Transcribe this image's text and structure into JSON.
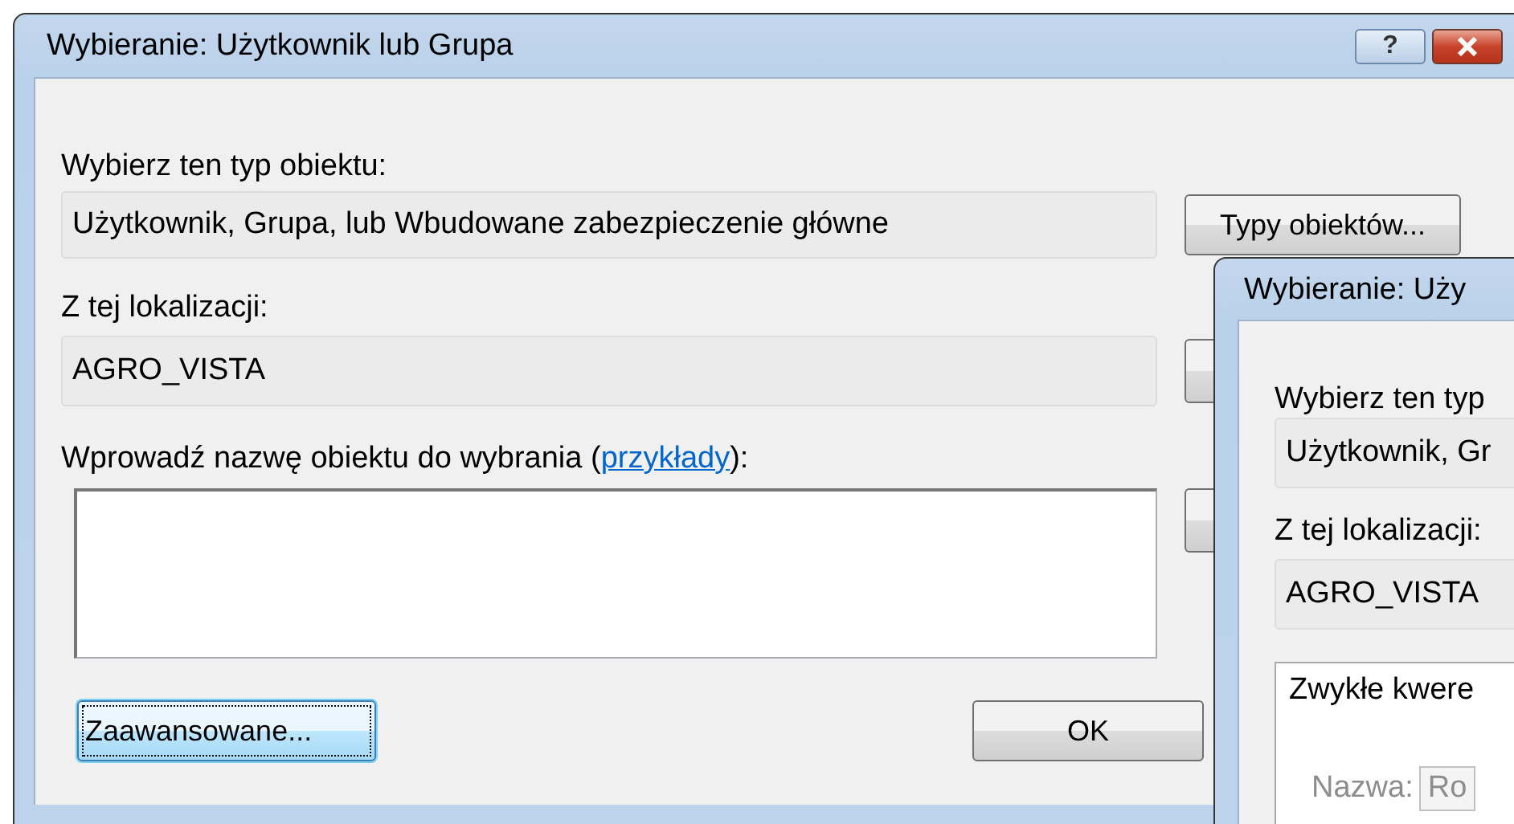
{
  "windows": [
    {
      "kind": "back",
      "title": "Wybieranie: Użytkownik lub Grupa",
      "help_button": "?",
      "object_type": {
        "label": "Wybierz ten typ obiektu:",
        "value": "Użytkownik, Grupa, lub Wbudowane zabezpieczenie główne",
        "button": "Typy obiektów..."
      },
      "location": {
        "label": "Z tej lokalizacji:",
        "value": "AGRO_VISTA"
      },
      "names": {
        "label": "Wprowadź nazwę obiektu do wybrania (",
        "link": "przykłady",
        "label_end": "):"
      },
      "buttons": [
        {
          "label": "Zaawansowane...",
          "focused": true
        },
        {
          "label": "OK",
          "focused": false
        }
      ]
    },
    {
      "kind": "front",
      "title": "Wybieranie: Uży",
      "object_type": {
        "label": "Wybierz ten typ",
        "value": "Użytkownik, Gr"
      },
      "location": {
        "label": "Z tej lokalizacji:",
        "value": "AGRO_VISTA"
      },
      "query_group": {
        "title": "Zwykłe kwere",
        "name_label": "Nazwa:",
        "name_value": "Ro",
        "disabled": true
      }
    }
  ]
}
